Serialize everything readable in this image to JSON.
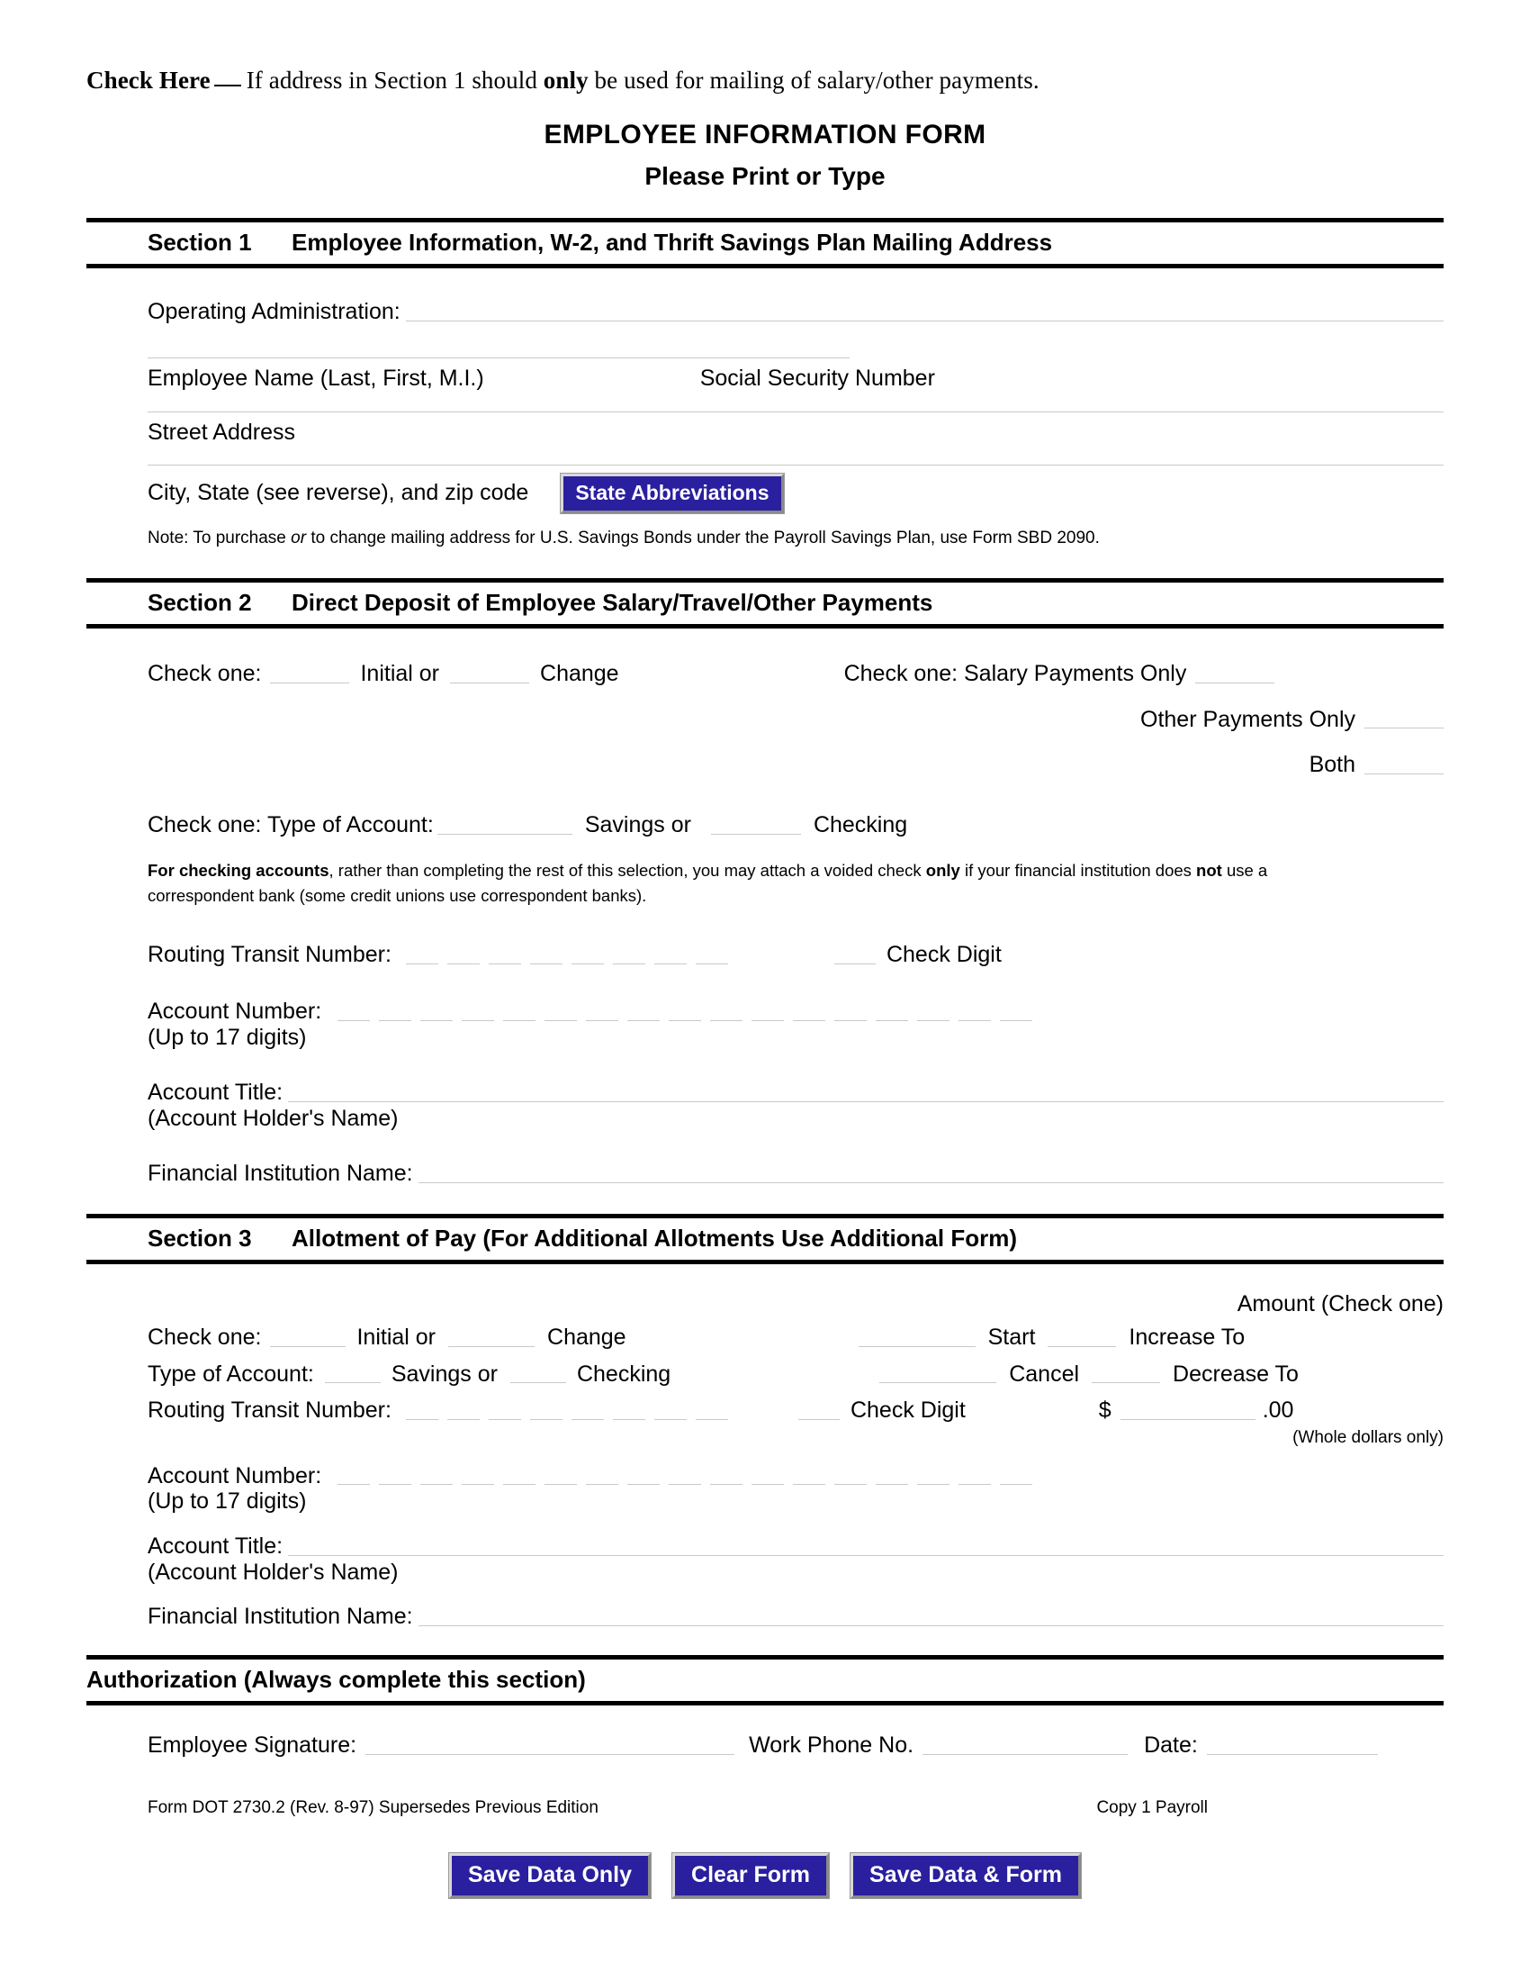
{
  "header": {
    "check_here_label": "Check Here",
    "check_here_text_before": "If address in Section 1 should ",
    "check_here_bold": "only",
    "check_here_text_after": " be used for mailing of salary/other payments.",
    "title": "EMPLOYEE INFORMATION FORM",
    "subtitle": "Please Print or Type"
  },
  "section1": {
    "number": "Section 1",
    "title": "Employee Information, W-2, and Thrift Savings Plan Mailing Address",
    "operating_administration_label": "Operating Administration:",
    "employee_name_label": "Employee Name (Last, First, M.I.)",
    "ssn_label": "Social Security Number",
    "street_address_label": "Street Address",
    "city_state_label": "City, State (see reverse), and zip code",
    "state_abbreviations_button": "State Abbreviations",
    "note_prefix": "Note: To purchase ",
    "note_italic": "or",
    "note_suffix": " to change mailing address for U.S. Savings Bonds under the Payroll Savings Plan, use Form SBD 2090."
  },
  "section2": {
    "number": "Section 2",
    "title": "Direct Deposit of Employee Salary/Travel/Other Payments",
    "check_one_label": "Check one:",
    "initial_label": "Initial or",
    "change_label": "Change",
    "payment_check_one_label": "Check one: Salary Payments Only",
    "other_payments_label": "Other  Payments Only",
    "both_label": "Both",
    "type_of_account_label": "Check one: Type of Account:",
    "savings_label": "Savings or",
    "checking_label": "Checking",
    "fine_print_bold_1": "For checking accounts",
    "fine_print_1": ", rather than completing the rest of this selection, you may attach a voided check ",
    "fine_print_bold_2": "only",
    "fine_print_2": " if your financial institution does ",
    "fine_print_bold_3": "not",
    "fine_print_3": " use a correspondent bank (some credit unions use correspondent banks).",
    "routing_label": "Routing Transit Number:",
    "check_digit_label": "Check Digit",
    "account_number_label": "Account Number:",
    "account_number_sub": "(Up to 17 digits)",
    "account_title_label": "Account Title:",
    "account_title_sub": "(Account Holder's Name)",
    "financial_institution_label": "Financial Institution Name:"
  },
  "section3": {
    "number": "Section 3",
    "title": "Allotment of Pay (For Additional Allotments Use Additional Form)",
    "amount_header": "Amount (Check one)",
    "check_one_label": "Check one:",
    "initial_label": "Initial or",
    "change_label": "Change",
    "start_label": "Start",
    "increase_to_label": "Increase To",
    "type_of_account_label": "Type of Account:",
    "savings_label": "Savings or",
    "checking_label": "Checking",
    "cancel_label": "Cancel",
    "decrease_to_label": "Decrease To",
    "routing_label": "Routing Transit Number:",
    "check_digit_label": "Check Digit",
    "dollar_sign": "$",
    "cents_label": ".00",
    "whole_dollars_note": "(Whole dollars only)",
    "account_number_label": "Account Number:",
    "account_number_sub": "(Up to 17 digits)",
    "account_title_label": "Account Title:",
    "account_title_sub": "(Account Holder's Name)",
    "financial_institution_label": "Financial Institution Name:"
  },
  "authorization": {
    "title": "Authorization (Always complete this section)",
    "signature_label": "Employee Signature:",
    "work_phone_label": "Work Phone No.",
    "date_label": "Date:"
  },
  "footer": {
    "form_id": "Form DOT 2730.2 (Rev. 8-97) Supersedes Previous Edition",
    "copy": "Copy 1  Payroll"
  },
  "actions": {
    "save_data_only": "Save Data Only",
    "clear_form": "Clear Form",
    "save_data_and_form": "Save Data & Form"
  },
  "colors": {
    "button_blue": "#2a1f9e",
    "button_text": "#ffffff",
    "rule_gray": "#c9c9c9",
    "bar_black": "#000000"
  }
}
